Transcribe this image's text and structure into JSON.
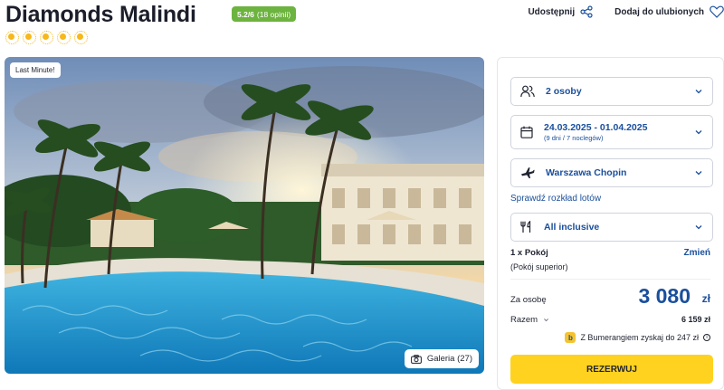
{
  "hotel": {
    "name": "Diamonds Malindi",
    "rating_text": "5.2/6",
    "rating_count": "(18 opinii)",
    "suns": 5
  },
  "top_actions": {
    "share_label": "Udostępnij",
    "favorite_label": "Dodaj do ulubionych"
  },
  "photo": {
    "badge": "Last Minute!",
    "gallery_label": "Galeria (27)"
  },
  "booking": {
    "guests": "2 osoby",
    "dates": "24.03.2025 - 01.04.2025",
    "dates_sub": "(9 dni / 7 noclegów)",
    "departure": "Warszawa Chopin",
    "flight_link": "Sprawdź rozkład lotów",
    "board": "All inclusive",
    "room_count": "1 x Pokój",
    "room_change": "Zmień",
    "room_type": "(Pokój superior)",
    "per_person_label": "Za osobę",
    "per_person_price": "3 080",
    "currency": "zł",
    "total_label": "Razem",
    "total_value": "6 159 zł",
    "boomerang_text": "Z Bumerangiem zyskaj do 247 zł",
    "reserve_label": "REZERWUJ"
  },
  "colors": {
    "accent_blue": "#1a4f9c",
    "rating_green": "#6db33f",
    "reserve_yellow": "#ffd21f",
    "sun_orange": "#f6b81a"
  }
}
